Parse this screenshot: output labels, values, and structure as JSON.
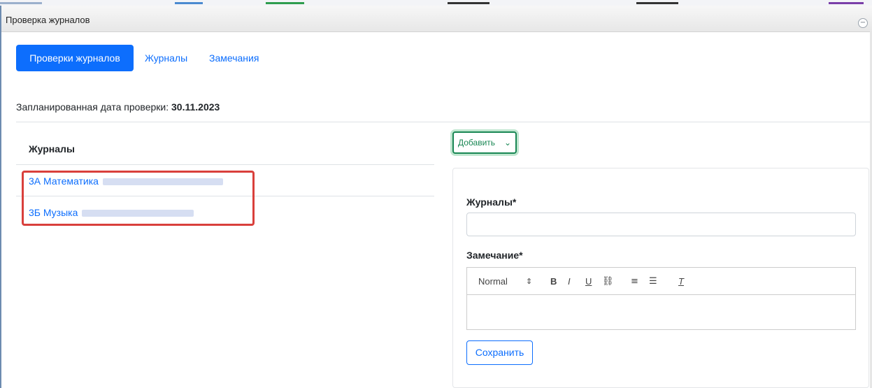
{
  "window": {
    "title": "Проверка журналов",
    "collapse_glyph": "−"
  },
  "tabs": [
    {
      "label": "Проверки журналов",
      "active": true
    },
    {
      "label": "Журналы",
      "active": false
    },
    {
      "label": "Замечания",
      "active": false
    }
  ],
  "planned": {
    "label": "Запланированная дата проверки: ",
    "date": "30.11.2023"
  },
  "journals": {
    "heading": "Журналы",
    "items": [
      {
        "label": "3А Математика"
      },
      {
        "label": "3Б Музыка"
      }
    ]
  },
  "add_button": {
    "label": "Добавить",
    "icon": "chevron-down-icon"
  },
  "form": {
    "journals_label": "Журналы*",
    "journals_value": "",
    "remark_label": "Замечание*",
    "toolbar": {
      "format": "Normal"
    },
    "save_label": "Сохранить"
  },
  "colors": {
    "primary": "#0d6efd",
    "success": "#198754",
    "highlight": "#d9403c"
  }
}
